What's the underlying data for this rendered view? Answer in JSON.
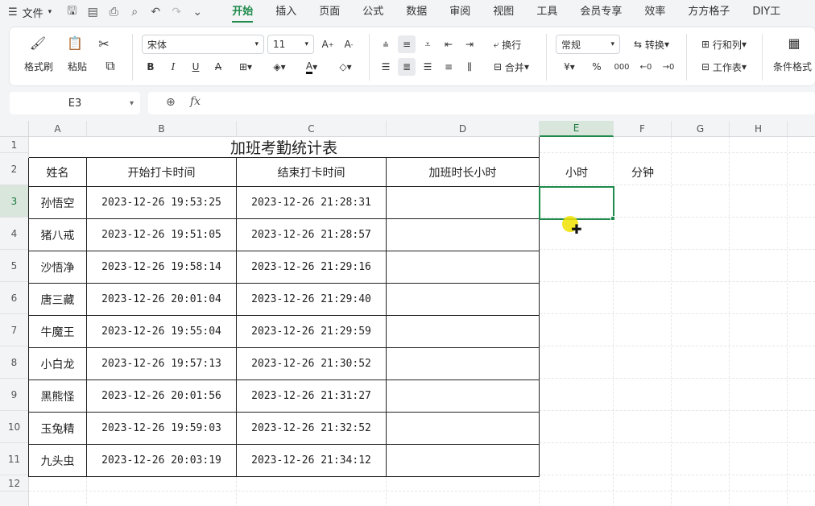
{
  "menubar": {
    "file_label": "文件",
    "tabs": [
      {
        "label": "开始"
      },
      {
        "label": "插入"
      },
      {
        "label": "页面"
      },
      {
        "label": "公式"
      },
      {
        "label": "数据"
      },
      {
        "label": "审阅"
      },
      {
        "label": "视图"
      },
      {
        "label": "工具"
      },
      {
        "label": "会员专享"
      },
      {
        "label": "效率"
      },
      {
        "label": "方方格子"
      },
      {
        "label": "DIY工"
      }
    ]
  },
  "ribbon": {
    "format_painter": "格式刷",
    "paste": "粘贴",
    "font_name": "宋体",
    "font_size": "11",
    "wrap": "换行",
    "merge": "合并",
    "number_format": "常规",
    "convert": "转换",
    "row_col": "行和列",
    "worksheet": "工作表",
    "cond_format": "条件格式",
    "currency": "¥",
    "percent": "%"
  },
  "formula_bar": {
    "cell_ref": "E3",
    "fx": "fx",
    "content": ""
  },
  "sheet": {
    "columns": [
      "A",
      "B",
      "C",
      "D",
      "E",
      "F",
      "G",
      "H"
    ],
    "rows": [
      "1",
      "2",
      "3",
      "4",
      "5",
      "6",
      "7",
      "8",
      "9",
      "10",
      "11",
      "12"
    ],
    "selected_col": "E",
    "selected_row": "3",
    "title": "加班考勤统计表",
    "headers": {
      "name": "姓名",
      "start": "开始打卡时间",
      "end": "结束打卡时间",
      "overtime": "加班时长小时",
      "hours": "小时",
      "minutes": "分钟"
    },
    "records": [
      {
        "name": "孙悟空",
        "start": "2023-12-26 19:53:25",
        "end": "2023-12-26 21:28:31"
      },
      {
        "name": "猪八戒",
        "start": "2023-12-26 19:51:05",
        "end": "2023-12-26 21:28:57"
      },
      {
        "name": "沙悟净",
        "start": "2023-12-26 19:58:14",
        "end": "2023-12-26 21:29:16"
      },
      {
        "name": "唐三藏",
        "start": "2023-12-26 20:01:04",
        "end": "2023-12-26 21:29:40"
      },
      {
        "name": "牛魔王",
        "start": "2023-12-26 19:55:04",
        "end": "2023-12-26 21:29:59"
      },
      {
        "name": "小白龙",
        "start": "2023-12-26 19:57:13",
        "end": "2023-12-26 21:30:52"
      },
      {
        "name": "黑熊怪",
        "start": "2023-12-26 20:01:56",
        "end": "2023-12-26 21:31:27"
      },
      {
        "name": "玉兔精",
        "start": "2023-12-26 19:59:03",
        "end": "2023-12-26 21:32:52"
      },
      {
        "name": "九头虫",
        "start": "2023-12-26 20:03:19",
        "end": "2023-12-26 21:34:12"
      }
    ]
  },
  "colors": {
    "accent": "#1f8a4c",
    "selection": "#d8e6dc"
  }
}
